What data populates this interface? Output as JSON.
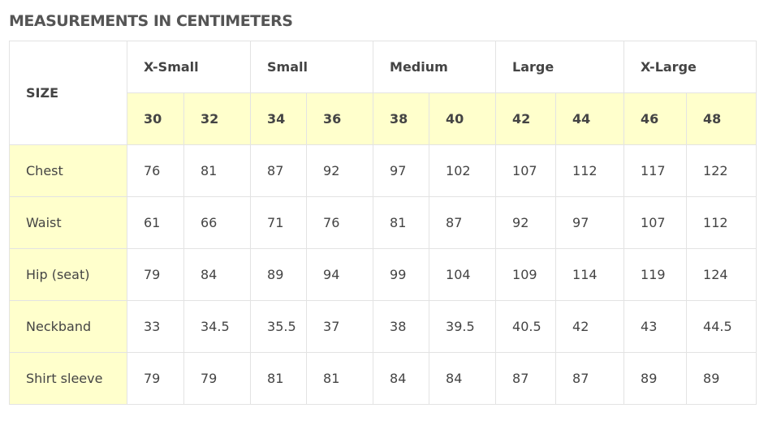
{
  "title": "MEASUREMENTS IN CENTIMETERS",
  "size_header": "SIZE",
  "size_groups": [
    {
      "label": "X-Small",
      "sizes": [
        "30",
        "32"
      ]
    },
    {
      "label": "Small",
      "sizes": [
        "34",
        "36"
      ]
    },
    {
      "label": "Medium",
      "sizes": [
        "38",
        "40"
      ]
    },
    {
      "label": "Large",
      "sizes": [
        "42",
        "44"
      ]
    },
    {
      "label": "X-Large",
      "sizes": [
        "46",
        "48"
      ]
    }
  ],
  "rows": [
    {
      "label": "Chest",
      "values": [
        "76",
        "81",
        "87",
        "92",
        "97",
        "102",
        "107",
        "112",
        "117",
        "122"
      ]
    },
    {
      "label": "Waist",
      "values": [
        "61",
        "66",
        "71",
        "76",
        "81",
        "87",
        "92",
        "97",
        "107",
        "112"
      ]
    },
    {
      "label": "Hip (seat)",
      "values": [
        "79",
        "84",
        "89",
        "94",
        "99",
        "104",
        "109",
        "114",
        "119",
        "124"
      ]
    },
    {
      "label": "Neckband",
      "values": [
        "33",
        "34.5",
        "35.5",
        "37",
        "38",
        "39.5",
        "40.5",
        "42",
        "43",
        "44.5"
      ]
    },
    {
      "label": "Shirt sleeve",
      "values": [
        "79",
        "79",
        "81",
        "81",
        "84",
        "84",
        "87",
        "87",
        "89",
        "89"
      ]
    }
  ],
  "colors": {
    "highlight": "#ffffcc",
    "border": "#e3e3e3",
    "heading": "#555555"
  }
}
